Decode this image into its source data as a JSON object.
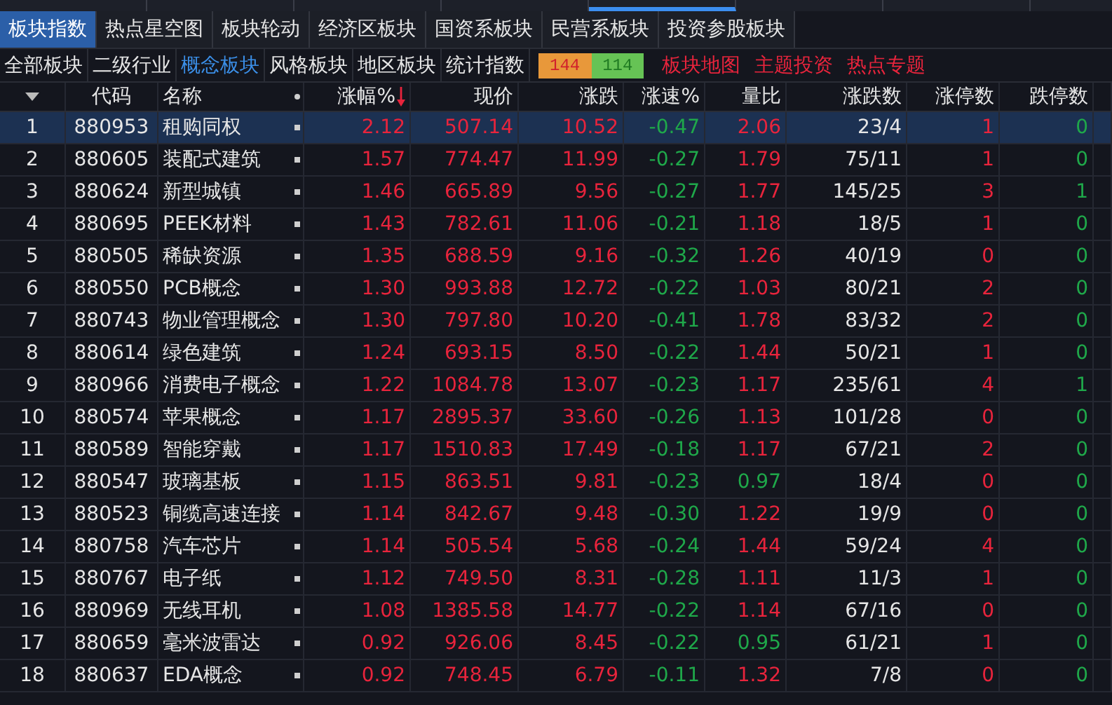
{
  "top_strip": {
    "segments": [
      {
        "selected": false
      },
      {
        "selected": false
      },
      {
        "selected": false
      },
      {
        "selected": false
      },
      {
        "selected": true
      },
      {
        "selected": false
      },
      {
        "selected": false
      },
      {
        "selected": false
      }
    ]
  },
  "tabs": [
    {
      "label": "板块指数",
      "selected": true
    },
    {
      "label": "热点星空图",
      "selected": false
    },
    {
      "label": "板块轮动",
      "selected": false
    },
    {
      "label": "经济区板块",
      "selected": false
    },
    {
      "label": "国资系板块",
      "selected": false
    },
    {
      "label": "民营系板块",
      "selected": false
    },
    {
      "label": "投资参股板块",
      "selected": false
    }
  ],
  "sub_tabs": [
    {
      "label": "全部板块",
      "selected": false
    },
    {
      "label": "二级行业",
      "selected": false
    },
    {
      "label": "概念板块",
      "selected": true
    },
    {
      "label": "风格板块",
      "selected": false
    },
    {
      "label": "地区板块",
      "selected": false
    },
    {
      "label": "统计指数",
      "selected": false
    }
  ],
  "breadth": {
    "up": "144",
    "down": "114"
  },
  "links": [
    "板块地图",
    "主题投资",
    "热点专题"
  ],
  "table": {
    "columns": [
      {
        "kind": "menu",
        "sorted": false
      },
      {
        "label": "代码",
        "kind": "code",
        "sorted": false
      },
      {
        "label": "名称",
        "kind": "name",
        "sorted": false
      },
      {
        "label": "涨幅%",
        "kind": "num",
        "color": "#e8243c",
        "sorted": true
      },
      {
        "label": "现价",
        "kind": "num",
        "color": "#e8243c",
        "sorted": false
      },
      {
        "label": "涨跌",
        "kind": "num",
        "color": "#e8243c",
        "sorted": false
      },
      {
        "label": "涨速%",
        "kind": "num",
        "color": "#1fa84a",
        "sorted": false
      },
      {
        "label": "量比",
        "kind": "mixed",
        "sorted": false
      },
      {
        "label": "涨跌数",
        "kind": "num",
        "sorted": false
      },
      {
        "label": "涨停数",
        "kind": "num",
        "color": "#e8243c",
        "sorted": false
      },
      {
        "label": "跌停数",
        "kind": "num",
        "color": "#1fa84a",
        "sorted": false
      }
    ],
    "rows": [
      {
        "selected": true,
        "ratio_up": true,
        "cells": [
          "1",
          "880953",
          "租购同权",
          "2.12",
          "507.14",
          "10.52",
          "-0.47",
          "2.06",
          "23/4",
          "1",
          "0"
        ]
      },
      {
        "selected": false,
        "ratio_up": true,
        "cells": [
          "2",
          "880605",
          "装配式建筑",
          "1.57",
          "774.47",
          "11.99",
          "-0.27",
          "1.79",
          "75/11",
          "1",
          "0"
        ]
      },
      {
        "selected": false,
        "ratio_up": true,
        "cells": [
          "3",
          "880624",
          "新型城镇",
          "1.46",
          "665.89",
          "9.56",
          "-0.27",
          "1.77",
          "145/25",
          "3",
          "1"
        ]
      },
      {
        "selected": false,
        "ratio_up": true,
        "cells": [
          "4",
          "880695",
          "PEEK材料",
          "1.43",
          "782.61",
          "11.06",
          "-0.21",
          "1.18",
          "18/5",
          "1",
          "0"
        ]
      },
      {
        "selected": false,
        "ratio_up": true,
        "cells": [
          "5",
          "880505",
          "稀缺资源",
          "1.35",
          "688.59",
          "9.16",
          "-0.32",
          "1.26",
          "40/19",
          "0",
          "0"
        ]
      },
      {
        "selected": false,
        "ratio_up": true,
        "cells": [
          "6",
          "880550",
          "PCB概念",
          "1.30",
          "993.88",
          "12.72",
          "-0.22",
          "1.03",
          "80/21",
          "2",
          "0"
        ]
      },
      {
        "selected": false,
        "ratio_up": true,
        "cells": [
          "7",
          "880743",
          "物业管理概念",
          "1.30",
          "797.80",
          "10.20",
          "-0.41",
          "1.78",
          "83/32",
          "2",
          "0"
        ]
      },
      {
        "selected": false,
        "ratio_up": true,
        "cells": [
          "8",
          "880614",
          "绿色建筑",
          "1.24",
          "693.15",
          "8.50",
          "-0.22",
          "1.44",
          "50/21",
          "1",
          "0"
        ]
      },
      {
        "selected": false,
        "ratio_up": true,
        "cells": [
          "9",
          "880966",
          "消费电子概念",
          "1.22",
          "1084.78",
          "13.07",
          "-0.23",
          "1.17",
          "235/61",
          "4",
          "1"
        ]
      },
      {
        "selected": false,
        "ratio_up": true,
        "cells": [
          "10",
          "880574",
          "苹果概念",
          "1.17",
          "2895.37",
          "33.60",
          "-0.26",
          "1.13",
          "101/28",
          "0",
          "0"
        ]
      },
      {
        "selected": false,
        "ratio_up": true,
        "cells": [
          "11",
          "880589",
          "智能穿戴",
          "1.17",
          "1510.83",
          "17.49",
          "-0.18",
          "1.17",
          "67/21",
          "2",
          "0"
        ]
      },
      {
        "selected": false,
        "ratio_up": false,
        "cells": [
          "12",
          "880547",
          "玻璃基板",
          "1.15",
          "863.51",
          "9.81",
          "-0.23",
          "0.97",
          "18/4",
          "0",
          "0"
        ]
      },
      {
        "selected": false,
        "ratio_up": true,
        "cells": [
          "13",
          "880523",
          "铜缆高速连接",
          "1.14",
          "842.67",
          "9.48",
          "-0.30",
          "1.22",
          "19/9",
          "0",
          "0"
        ]
      },
      {
        "selected": false,
        "ratio_up": true,
        "cells": [
          "14",
          "880758",
          "汽车芯片",
          "1.14",
          "505.54",
          "5.68",
          "-0.24",
          "1.44",
          "59/24",
          "4",
          "0"
        ]
      },
      {
        "selected": false,
        "ratio_up": true,
        "cells": [
          "15",
          "880767",
          "电子纸",
          "1.12",
          "749.50",
          "8.31",
          "-0.28",
          "1.11",
          "11/3",
          "1",
          "0"
        ]
      },
      {
        "selected": false,
        "ratio_up": true,
        "cells": [
          "16",
          "880969",
          "无线耳机",
          "1.08",
          "1385.58",
          "14.77",
          "-0.22",
          "1.14",
          "67/16",
          "0",
          "0"
        ]
      },
      {
        "selected": false,
        "ratio_up": false,
        "cells": [
          "17",
          "880659",
          "毫米波雷达",
          "0.92",
          "926.06",
          "8.45",
          "-0.22",
          "0.95",
          "61/21",
          "1",
          "0"
        ]
      },
      {
        "selected": false,
        "ratio_up": true,
        "cells": [
          "18",
          "880637",
          "EDA概念",
          "0.92",
          "748.45",
          "6.79",
          "-0.11",
          "1.32",
          "7/8",
          "0",
          "0"
        ]
      }
    ]
  }
}
